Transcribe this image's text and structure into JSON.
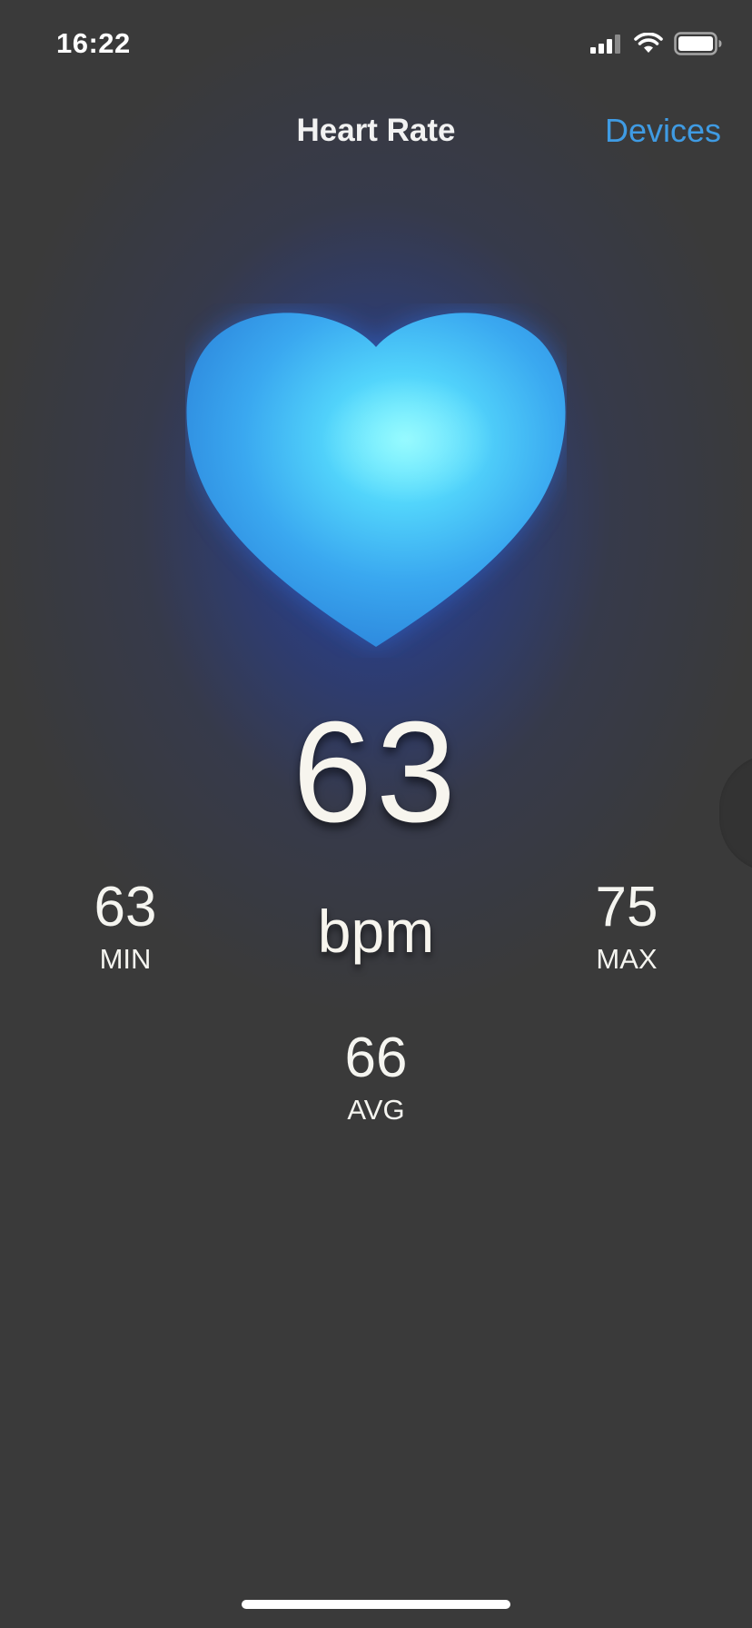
{
  "status_bar": {
    "time": "16:22",
    "icons": [
      "signal-icon",
      "wifi-icon",
      "battery-icon"
    ]
  },
  "nav": {
    "title": "Heart Rate",
    "devices_label": "Devices"
  },
  "reading": {
    "value": "63",
    "unit": "bpm"
  },
  "stats": {
    "min": {
      "value": "63",
      "label": "MIN"
    },
    "max": {
      "value": "75",
      "label": "MAX"
    },
    "avg": {
      "value": "66",
      "label": "AVG"
    }
  },
  "colors": {
    "accent": "#3f9be3",
    "heart": "#3aa8f0",
    "background": "#3a3a3a"
  }
}
